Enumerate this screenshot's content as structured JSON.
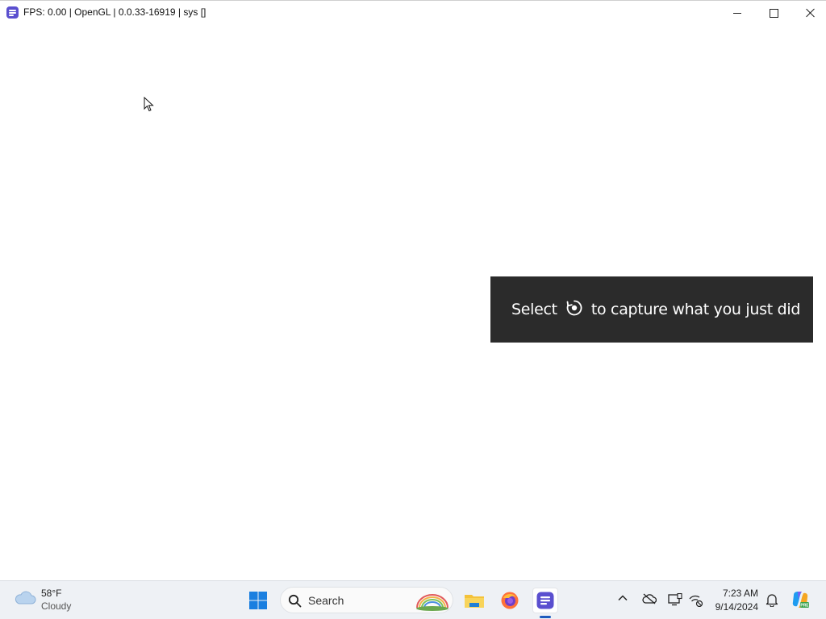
{
  "window": {
    "title": "FPS: 0.00 | OpenGL | 0.0.33-16919 | sys []",
    "minimize_label": "",
    "maximize_label": "",
    "close_label": ""
  },
  "toast": {
    "prefix": "Select",
    "suffix": "to capture what you just did",
    "icon": "capture-icon"
  },
  "taskbar": {
    "weather": {
      "temp": "58°F",
      "condition": "Cloudy",
      "icon": "cloud-icon"
    },
    "search": {
      "placeholder": "Search"
    },
    "apps": [
      {
        "name": "file-explorer",
        "icon": "folder-icon"
      },
      {
        "name": "firefox",
        "icon": "firefox-icon"
      },
      {
        "name": "current-app",
        "icon": "app-icon",
        "active": true
      }
    ],
    "tray": {
      "icons": [
        "chevron-up-icon",
        "onedrive-offline-icon",
        "display-icon",
        "network-icon",
        "notification-bell-icon",
        "copilot-icon"
      ]
    },
    "clock": {
      "time": "7:23 AM",
      "date": "9/14/2024"
    }
  },
  "colors": {
    "toast_bg": "#2b2b2b",
    "taskbar_bg": "#eef1f5",
    "accent": "#1e5bbd",
    "app_icon": "#5a4fcf"
  }
}
